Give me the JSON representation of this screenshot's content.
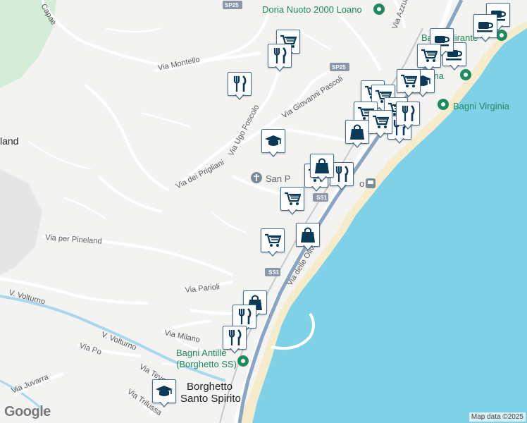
{
  "map": {
    "colors": {
      "land": "#f3f3f1",
      "sea": "#7fd1e7",
      "beach": "#f6eccb",
      "park": "#d5ecd8",
      "road": "#ffffff",
      "highway": "#8aa4c4",
      "river": "#a9d8ee",
      "marker": "#0b3a59"
    },
    "road_labels": [
      {
        "id": "via-montello",
        "text": "Via Montello"
      },
      {
        "id": "via-ugo-foscolo",
        "text": "Via Ugo Foscolo"
      },
      {
        "id": "via-giovanni-pascoli",
        "text": "Via Giovanni Pascoli"
      },
      {
        "id": "via-dei-prigliani",
        "text": "Via dei Prigliani"
      },
      {
        "id": "via-per-pineland",
        "text": "Via per Pineland"
      },
      {
        "id": "v-volturno-1",
        "text": "V. Volturno"
      },
      {
        "id": "v-volturno-2",
        "text": "V. Volturno"
      },
      {
        "id": "via-parioli",
        "text": "Via Parioli"
      },
      {
        "id": "via-milano",
        "text": "Via Milano"
      },
      {
        "id": "via-po",
        "text": "Via Po"
      },
      {
        "id": "via-juvarra",
        "text": "Via Juvarra"
      },
      {
        "id": "via-tevere",
        "text": "Via Tevere"
      },
      {
        "id": "via-trilussa",
        "text": "Via Trilussa"
      },
      {
        "id": "via-delle-olivete",
        "text": "Via delle Olivete"
      },
      {
        "id": "via-azzurri",
        "text": "Via Azzurri"
      },
      {
        "id": "capae",
        "text": "Capae"
      },
      {
        "id": "land-fragment",
        "text": "land"
      }
    ],
    "shields": {
      "sp25_top": "SP25",
      "sp25_mid": "SP25",
      "ss1_mid": "SS1",
      "ss1_low": "SS1"
    },
    "pois": {
      "doria_nuoto": "Doria Nuoto 2000 Loano",
      "bagni_virginia": "Bagni Virginia",
      "bagni_mirante": "Bagni Mirante",
      "bagni_antille_1": "Bagni Antille",
      "bagni_antille_2": "(Borghetto SS)",
      "san_p": "San P",
      "station_o": "o",
      "bagni_ma": "Ba       na"
    },
    "town": {
      "line1": "Borghetto",
      "line2": "Santo Spirito"
    },
    "markers": [
      {
        "icon": "cart"
      },
      {
        "icon": "fork-knife"
      },
      {
        "icon": "fork-knife"
      },
      {
        "icon": "coffee"
      },
      {
        "icon": "coffee"
      },
      {
        "icon": "coffee"
      },
      {
        "icon": "coffee"
      },
      {
        "icon": "cart"
      },
      {
        "icon": "graduation-cap"
      },
      {
        "icon": "cart"
      },
      {
        "icon": "cart"
      },
      {
        "icon": "cart"
      },
      {
        "icon": "cart"
      },
      {
        "icon": "cart"
      },
      {
        "icon": "fork-knife"
      },
      {
        "icon": "shopping-bag"
      },
      {
        "icon": "graduation-cap"
      },
      {
        "icon": "cart"
      },
      {
        "icon": "fork-knife"
      },
      {
        "icon": "fork-knife"
      },
      {
        "icon": "cart"
      },
      {
        "icon": "shopping-bag"
      },
      {
        "icon": "cart"
      },
      {
        "icon": "shopping-bag"
      },
      {
        "icon": "cart"
      },
      {
        "icon": "shopping-bag"
      },
      {
        "icon": "fork-knife"
      },
      {
        "icon": "fork-knife"
      },
      {
        "icon": "graduation-cap"
      }
    ],
    "google_logo": "Google",
    "attribution": "Map data ©2025"
  }
}
